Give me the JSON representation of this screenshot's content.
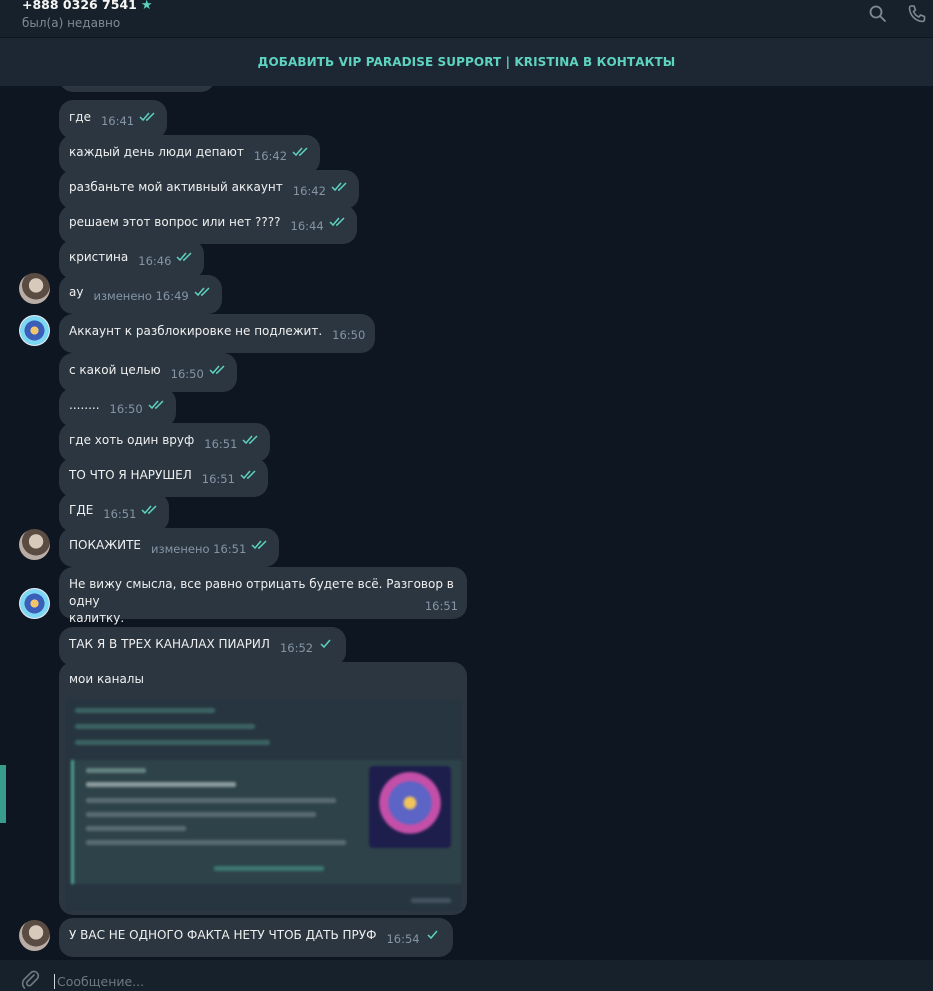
{
  "header": {
    "contact_name": "+888 0326 7541",
    "star_icon": "star-icon",
    "status": "был(а) недавно",
    "search_icon": "search-icon",
    "call_icon": "phone-icon"
  },
  "banner": {
    "text": "ДОБАВИТЬ VIP PARADISE SUPPORT | KRISTINA В КОНТАКТЫ"
  },
  "messages": [
    {
      "text": "где",
      "time": "16:41",
      "read": "double"
    },
    {
      "text": "каждый день люди депают",
      "time": "16:42",
      "read": "double"
    },
    {
      "text": "разбаньте мой активный аккаунт",
      "time": "16:42",
      "read": "double"
    },
    {
      "text": "решаем этот вопрос или нет ????",
      "time": "16:44",
      "read": "double"
    },
    {
      "text": "кристина",
      "time": "16:46",
      "read": "double"
    },
    {
      "text": "ау",
      "time": "изменено 16:49",
      "read": "double"
    },
    {
      "text": "Аккаунт к разблокировке не подлежит.",
      "time": "16:50"
    },
    {
      "text": "с какой целью",
      "time": "16:50",
      "read": "double"
    },
    {
      "text": "........",
      "time": "16:50",
      "read": "double"
    },
    {
      "text": "где хоть один вруф",
      "time": "16:51",
      "read": "double"
    },
    {
      "text": "ТО ЧТО Я НАРУШЕЛ",
      "time": "16:51",
      "read": "double"
    },
    {
      "text": "ГДЕ",
      "time": "16:51",
      "read": "double"
    },
    {
      "text": "ПОКАЖИТЕ",
      "time": "изменено 16:51",
      "read": "double"
    },
    {
      "text_line1": "Не вижу смысла, все равно отрицать будете всё. Разговор в одну",
      "text_line2": "калитку.",
      "time": "16:51"
    },
    {
      "text": "ТАК Я В ТРЕХ КАНАЛАХ ПИАРИЛ",
      "time": "16:52",
      "read": "single"
    },
    {
      "text": "мои каналы"
    },
    {
      "text": "У ВАС НЕ ОДНОГО ФАКТА НЕТУ ЧТОБ ДАТЬ ПРУФ",
      "time": "16:54",
      "read": "single"
    }
  ],
  "composer": {
    "placeholder": "Сообщение...",
    "attach_icon": "paperclip-icon"
  },
  "colors": {
    "accent": "#5ed3c0",
    "background": "#0e1621",
    "bubble": "#2b3640",
    "header": "#17212b"
  }
}
